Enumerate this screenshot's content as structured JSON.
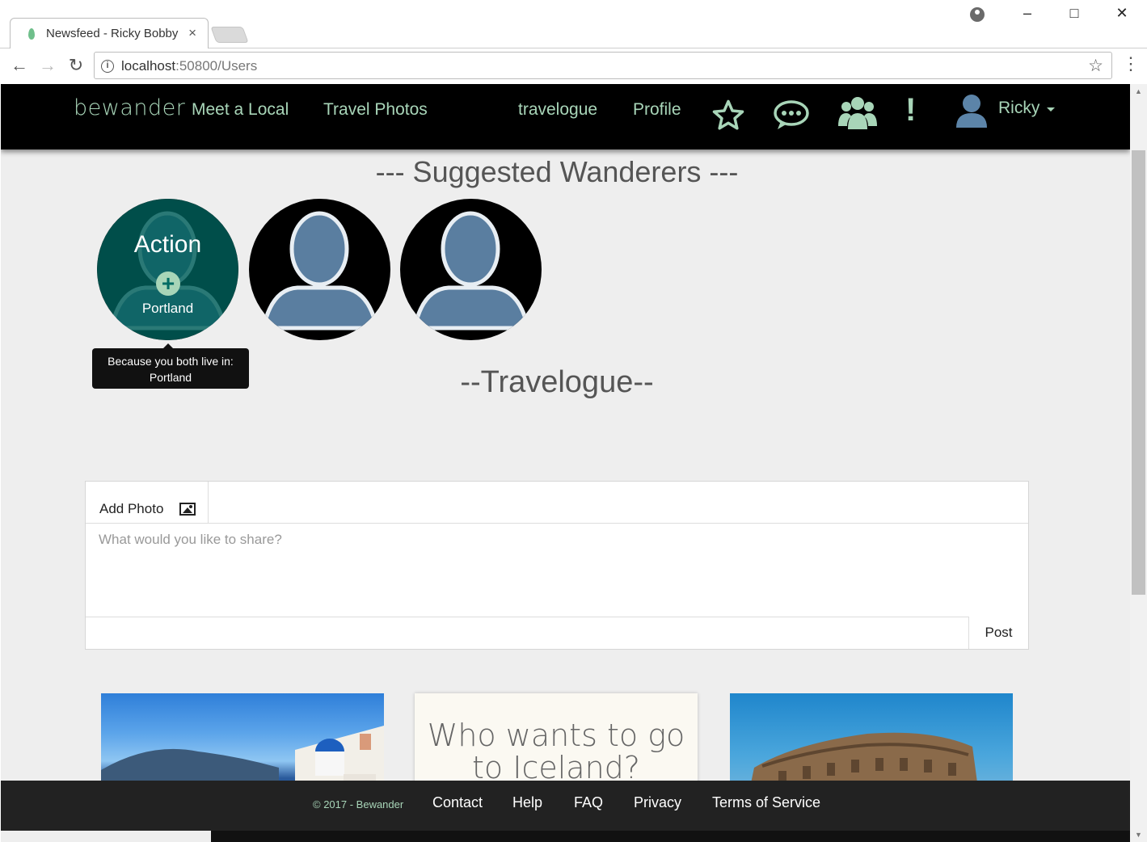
{
  "browser": {
    "tab_title": "Newsfeed - Ricky Bobby",
    "tab_close": "×",
    "url_host": "localhost",
    "url_path": ":50800/Users",
    "bookmark_star": "☆",
    "menu": "⋮",
    "back": "←",
    "forward": "→",
    "reload": "↻",
    "minimize": "–",
    "maximize": "□",
    "close": "✕",
    "info": "i"
  },
  "navbar": {
    "brand": "bewander",
    "links": [
      "Meet a Local",
      "Travel Photos",
      "travelogue",
      "Profile"
    ],
    "user": "Ricky",
    "icons": [
      "star-icon",
      "chat-icon",
      "group-icon",
      "alert-icon"
    ],
    "alert_glyph": "!"
  },
  "suggested": {
    "title": "--- Suggested Wanderers ---",
    "first": {
      "action": "Action",
      "plus": "+",
      "city": "Portland",
      "tooltip_line1": "Because you both live in:",
      "tooltip_line2": "Portland"
    }
  },
  "travelogue": {
    "title": "--Travelogue--",
    "add_photo": "Add Photo",
    "placeholder": "What would you like to share?",
    "post": "Post"
  },
  "cards": {
    "iceland_text": "Who wants to go to Iceland?"
  },
  "footer": {
    "copyright": "© 2017 - Bewander",
    "links": [
      "Contact",
      "Help",
      "FAQ",
      "Privacy",
      "Terms of Service"
    ]
  },
  "colors": {
    "accent": "#a8d5b8",
    "navbar_bg": "#000000",
    "page_bg": "#eeeeee",
    "teal_overlay": "#005f5a",
    "footer_bg": "#222222"
  }
}
